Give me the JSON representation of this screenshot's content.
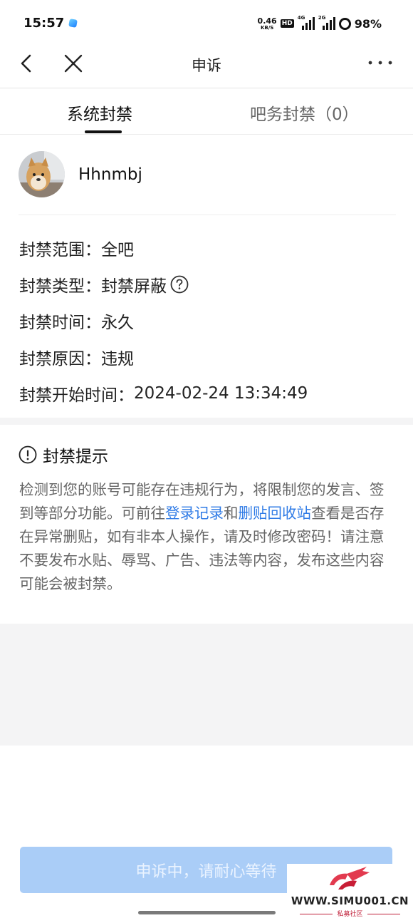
{
  "status_bar": {
    "time": "15:57",
    "net_speed_value": "0.46",
    "net_speed_unit": "KB/S",
    "hd_label": "HD",
    "sim1_label": "4G",
    "sim2_label": "2G",
    "battery": "98%"
  },
  "nav": {
    "title": "申诉",
    "back_icon": "back-chevron-icon",
    "close_icon": "close-icon",
    "more_icon": "more-dots-icon"
  },
  "tabs": [
    {
      "label": "系统封禁",
      "active": true
    },
    {
      "label": "吧务封禁（0）",
      "active": false
    }
  ],
  "user": {
    "name": "Hhnmbj"
  },
  "ban_info": {
    "scope_label": "封禁范围：",
    "scope_value": "全吧",
    "type_label": "封禁类型：",
    "type_value": "封禁屏蔽",
    "time_label": "封禁时间：",
    "time_value": "永久",
    "reason_label": "封禁原因：",
    "reason_value": "违规",
    "start_label": "封禁开始时间：",
    "start_value": "2024-02-24 13:34:49"
  },
  "notice": {
    "title": "封禁提示",
    "text_part1": "检测到您的账号可能存在违规行为，将限制您的发言、签到等部分功能。可前往",
    "link1": "登录记录",
    "text_and": "和",
    "link2": "删贴回收站",
    "text_part2": "查看是否存在异常删贴，如有非本人操作，请及时修改密码！请注意不要发布水贴、辱骂、广告、违法等内容，发布这些内容可能会被封禁。"
  },
  "appeal_button": {
    "label": "申诉中，请耐心等待"
  },
  "watermark": {
    "url": "WWW.SIMU001.CN",
    "sub": "私募社区"
  },
  "colors": {
    "link": "#2f7be6",
    "button_bg": "#aacdf7",
    "section_gap": "#f4f4f5"
  }
}
